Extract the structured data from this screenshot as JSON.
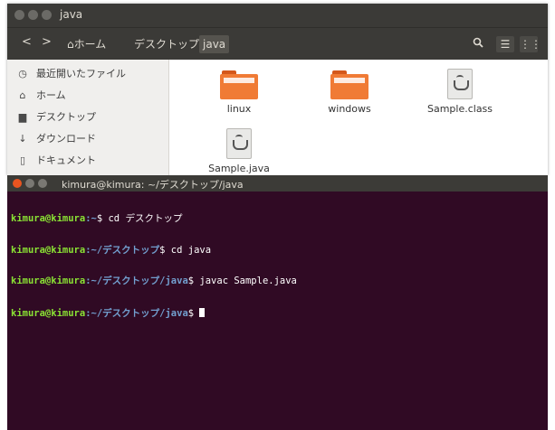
{
  "file_manager": {
    "title": "java",
    "nav": {
      "back": "<",
      "forward": ">"
    },
    "breadcrumbs": [
      "ホーム",
      "デスクトップ",
      "java"
    ],
    "sidebar": [
      {
        "icon": "clock-icon",
        "label": "最近開いたファイル"
      },
      {
        "icon": "home-icon",
        "label": "ホーム"
      },
      {
        "icon": "desktop-icon",
        "label": "デスクトップ"
      },
      {
        "icon": "download-icon",
        "label": "ダウンロード"
      },
      {
        "icon": "document-icon",
        "label": "ドキュメント"
      }
    ],
    "files": [
      {
        "name": "linux",
        "type": "folder"
      },
      {
        "name": "windows",
        "type": "folder"
      },
      {
        "name": "Sample.class",
        "type": "java-file"
      },
      {
        "name": "Sample.java",
        "type": "java-file"
      }
    ]
  },
  "terminal": {
    "title": "kimura@kimura: ~/デスクトップ/java",
    "lines": [
      {
        "user": "kimura@kimura",
        "path": ":~",
        "cmd": "$ cd デスクトップ"
      },
      {
        "user": "kimura@kimura",
        "path": ":~/デスクトップ",
        "cmd": "$ cd java"
      },
      {
        "user": "kimura@kimura",
        "path": ":~/デスクトップ/java",
        "cmd": "$ javac Sample.java"
      },
      {
        "user": "kimura@kimura",
        "path": ":~/デスクトップ/java",
        "cmd": "$ "
      }
    ]
  },
  "colors": {
    "terminal_bg": "#300a24",
    "prompt_user": "#8ae234",
    "prompt_path": "#729fcf",
    "folder": "#f07b35",
    "close_button": "#e95420"
  }
}
